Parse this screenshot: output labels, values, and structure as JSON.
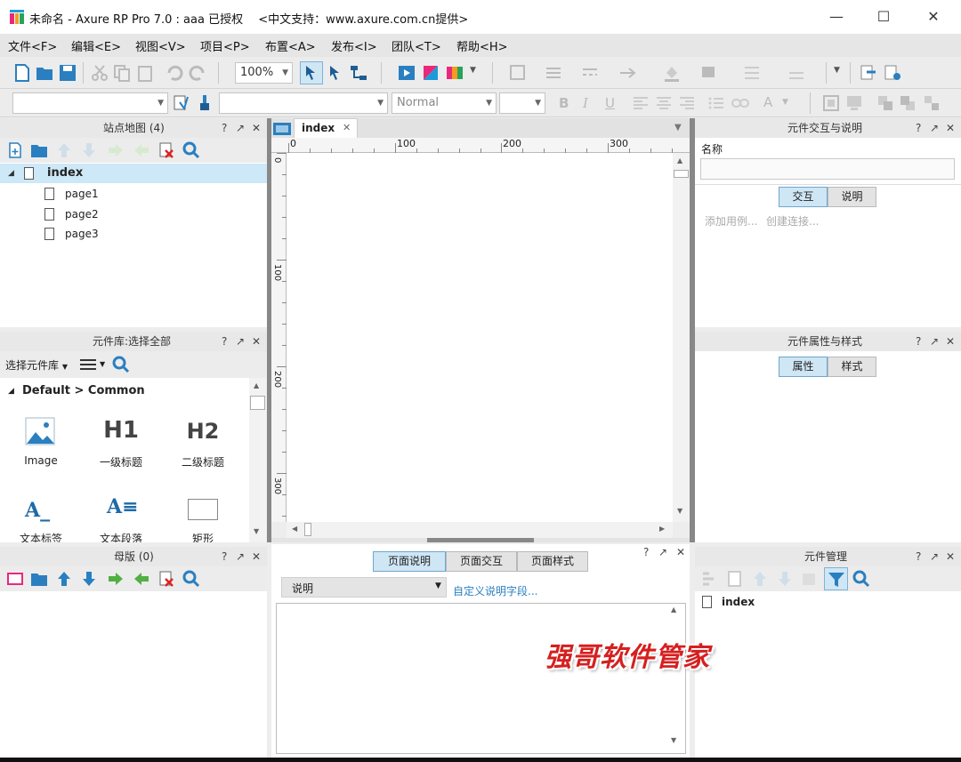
{
  "window": {
    "title": "未命名 - Axure RP Pro 7.0 : aaa 已授权　 <中文支持：www.axure.com.cn提供>",
    "minimize": "—",
    "maximize": "☐",
    "close": "✕"
  },
  "menu": [
    "文件<F>",
    "编辑<E>",
    "视图<V>",
    "项目<P>",
    "布置<A>",
    "发布<I>",
    "团队<T>",
    "帮助<H>"
  ],
  "toolbar": {
    "zoom": "100%",
    "style_value": "Normal"
  },
  "sitemap": {
    "title": "站点地图 (4)",
    "help": "?",
    "root": "index",
    "pages": [
      "page1",
      "page2",
      "page3"
    ]
  },
  "library": {
    "title": "元件库:选择全部",
    "select_label": "选择元件库",
    "group": "Default > Common",
    "widgets": [
      {
        "glyph": "",
        "label": "Image",
        "icon": "image-icon"
      },
      {
        "glyph": "H1",
        "label": "一级标题",
        "icon": "h1-icon"
      },
      {
        "glyph": "H2",
        "label": "二级标题",
        "icon": "h2-icon"
      },
      {
        "glyph": "A_",
        "label": "文本标签",
        "icon": "text-label-icon"
      },
      {
        "glyph": "A≡",
        "label": "文本段落",
        "icon": "paragraph-icon"
      },
      {
        "glyph": "",
        "label": "矩形",
        "icon": "rectangle-icon"
      }
    ]
  },
  "masters": {
    "title": "母版 (0)"
  },
  "canvas": {
    "tab": "index",
    "ruler_h": [
      "0",
      "100",
      "200",
      "300"
    ],
    "ruler_v": [
      "0",
      "100",
      "200",
      "300"
    ]
  },
  "page_notes": {
    "tabs": [
      "页面说明",
      "页面交互",
      "页面样式"
    ],
    "select": "说明",
    "custom_link": "自定义说明字段..."
  },
  "interactions": {
    "title": "元件交互与说明",
    "name_label": "名称",
    "tabs": [
      "交互",
      "说明"
    ],
    "add_case": "添加用例...",
    "create_link": "创建连接..."
  },
  "properties": {
    "title": "元件属性与样式",
    "tabs": [
      "属性",
      "样式"
    ]
  },
  "outline": {
    "title": "元件管理",
    "item": "index"
  },
  "watermark": "强哥软件管家",
  "colors": {
    "accent": "#2a7fc0",
    "selected_row": "#cde8f7",
    "watermark": "#d61f1f"
  }
}
